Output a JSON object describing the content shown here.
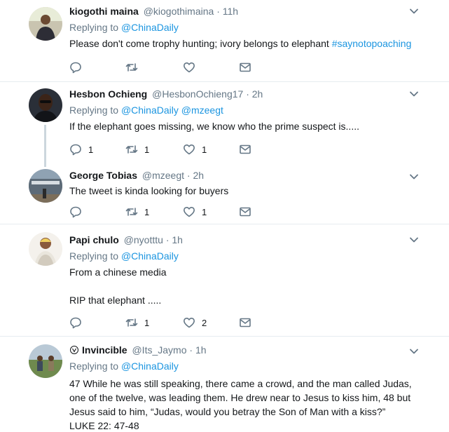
{
  "tweets": [
    {
      "name": "kiogothi maina",
      "handle": "@kiogothimaina",
      "dot": "·",
      "time": "11h",
      "replying_prefix": "Replying to",
      "replying_to": [
        "@ChinaDaily"
      ],
      "text_before": "Please don't come trophy hunting; ivory belongs to elephant ",
      "hashtag": "#saynotopoaching",
      "counts": {
        "reply": "",
        "retweet": "",
        "like": ""
      }
    },
    {
      "name": "Hesbon Ochieng",
      "handle": "@HesbonOchieng17",
      "dot": "·",
      "time": "2h",
      "replying_prefix": "Replying to",
      "replying_to": [
        "@ChinaDaily",
        "@mzeegt"
      ],
      "text": "If the elephant goes missing, we know who the prime suspect is.....",
      "counts": {
        "reply": "1",
        "retweet": "1",
        "like": "1"
      }
    },
    {
      "name": "George Tobias",
      "handle": "@mzeegt",
      "dot": "·",
      "time": "2h",
      "text": "The tweet is kinda looking for buyers",
      "counts": {
        "reply": "",
        "retweet": "1",
        "like": "1"
      }
    },
    {
      "name": "Papi chulo",
      "handle": "@nyotttu",
      "dot": "·",
      "time": "1h",
      "replying_prefix": "Replying to",
      "replying_to": [
        "@ChinaDaily"
      ],
      "text_line1": "From a chinese media",
      "text_line2": "RIP that elephant .....",
      "counts": {
        "reply": "",
        "retweet": "1",
        "like": "2"
      }
    },
    {
      "name": "Invincible",
      "handle": "@Its_Jaymo",
      "dot": "·",
      "time": "1h",
      "replying_prefix": "Replying to",
      "replying_to": [
        "@ChinaDaily"
      ],
      "text_line1": "47 While he was still speaking, there came a crowd, and the man called Judas,",
      "text_line2": "one of the twelve, was leading them. He drew near to Jesus to kiss him, 48 but",
      "text_line3": "Jesus said to him, “Judas, would you betray the Son of Man with a kiss?”",
      "text_line4": "LUKE 22: 47-48"
    }
  ],
  "colors": {
    "link": "#1b95e0",
    "secondary": "#657786",
    "text": "#14171a",
    "divider": "#e6ecf0",
    "thread_line": "#ccd6dd"
  }
}
